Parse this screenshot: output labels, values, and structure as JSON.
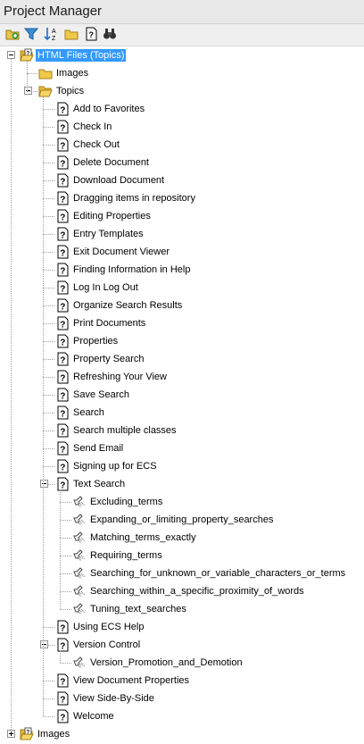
{
  "window": {
    "title": "Project Manager"
  },
  "toolbar": {
    "buttons": [
      {
        "icon": "add-folder-icon"
      },
      {
        "icon": "filter-icon"
      },
      {
        "icon": "sort-az-icon"
      },
      {
        "icon": "folder-icon"
      },
      {
        "icon": "help-topic-icon"
      },
      {
        "icon": "binoculars-icon"
      }
    ]
  },
  "tree": {
    "root": {
      "label": "HTML Files (Topics)",
      "selected": true,
      "expanded": true
    },
    "images_folder": {
      "label": "Images"
    },
    "topics_folder": {
      "label": "Topics",
      "expanded": true
    },
    "topics_before": [
      "Add to Favorites",
      "Check In",
      "Check Out",
      "Delete Document",
      "Download Document",
      "Dragging items in repository",
      "Editing Properties",
      "Entry Templates",
      "Exit Document Viewer",
      "Finding Information in Help",
      "Log In Log Out",
      "Organize Search Results",
      "Print Documents",
      "Properties",
      "Property Search",
      "Refreshing Your View",
      "Save Search",
      "Search",
      "Search multiple classes",
      "Send Email",
      "Signing up for ECS"
    ],
    "text_search": {
      "label": "Text Search",
      "expanded": true,
      "children": [
        "Excluding_terms",
        "Expanding_or_limiting_property_searches",
        "Matching_terms_exactly",
        "Requiring_terms",
        "Searching_for_unknown_or_variable_characters_or_terms",
        "Searching_within_a_specific_proximity_of_words",
        "Tuning_text_searches"
      ]
    },
    "using_help": "Using ECS Help",
    "version_control": {
      "label": "Version Control",
      "expanded": true,
      "children": [
        "Version_Promotion_and_Demotion"
      ]
    },
    "topics_after": [
      "View Document Properties",
      "View Side-By-Side",
      "Welcome"
    ],
    "bottom_root": {
      "label": "Images",
      "expanded": false
    }
  }
}
